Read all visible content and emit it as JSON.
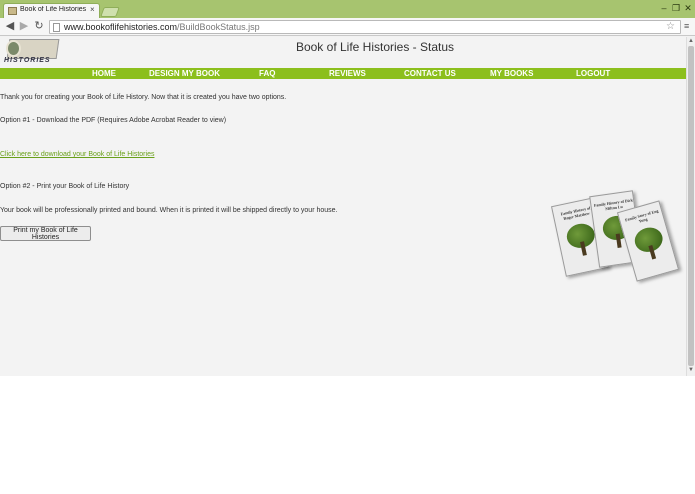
{
  "browser": {
    "tab_title": "Book of Life Histories - ws",
    "tab_close": "×",
    "url_host": "www.bookoflifehistories.com",
    "url_path": "/BuildBookStatus.jsp",
    "icons": {
      "back": "◀",
      "forward": "▶",
      "reload": "↻",
      "star": "☆",
      "menu": "≡",
      "minimize": "–",
      "maximize": "❐",
      "close": "✕",
      "scroll_up": "▲",
      "scroll_down": "▼"
    }
  },
  "site": {
    "logo_text": "HISTORIES",
    "title": "Book of Life Histories - Status"
  },
  "nav": {
    "home": "HOME",
    "design": "DESIGN MY BOOK",
    "faq": "FAQ",
    "reviews": "REVIEWS",
    "contact": "CONTACT US",
    "mybooks": "MY BOOKS",
    "logout": "LOGOUT"
  },
  "content": {
    "intro": "Thank you for creating your Book of Life History. Now that it is created you have two options.",
    "option1": "Option #1 - Download the PDF (Requires Adobe Acrobat Reader to view)",
    "download_link": "Click here to download your Book of Life Histories",
    "option2": "Option #2 - Print your Book of Life History",
    "printed_note": "Your book will be professionally printed and bound. When it is printed it will be shipped directly to your house.",
    "print_button": "Print my Book of Life Histories"
  },
  "books": [
    {
      "title": "Family History of Roger Matthew"
    },
    {
      "title": "Family History of Dick Milton Lu"
    },
    {
      "title": "Family Story of Eng Yung"
    }
  ],
  "colors": {
    "nav_green": "#8cbf1d",
    "link_green": "#6aa01a",
    "tab_bar": "#a7c46f"
  }
}
